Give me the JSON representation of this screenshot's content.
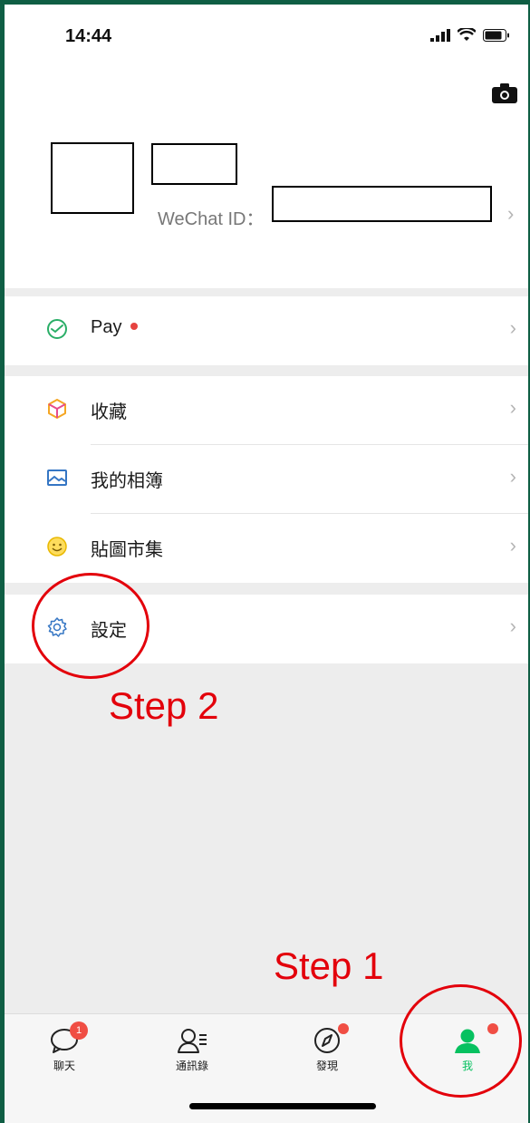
{
  "status_bar": {
    "time": "14:44"
  },
  "profile": {
    "wechat_id_label": "WeChat ID："
  },
  "menu": {
    "pay": {
      "label": "Pay"
    },
    "favorites": {
      "label": "收藏"
    },
    "album": {
      "label": "我的相簿"
    },
    "stickers": {
      "label": "貼圖市集"
    },
    "settings": {
      "label": "設定"
    }
  },
  "tabbar": {
    "tabs": [
      {
        "label": "聊天",
        "badge": "1"
      },
      {
        "label": "通訊錄"
      },
      {
        "label": "發現"
      },
      {
        "label": "我"
      }
    ]
  },
  "annotations": {
    "step1": "Step 1",
    "step2": "Step 2"
  },
  "colors": {
    "accent_green": "#07c160",
    "badge_red": "#f04e44",
    "annotation_red": "#e3000b",
    "frame_green": "#0f5e44"
  }
}
